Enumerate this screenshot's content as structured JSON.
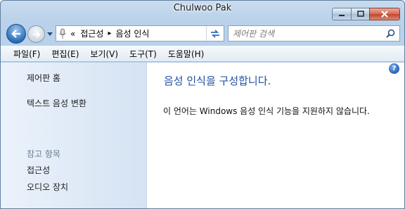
{
  "window": {
    "title": "Chulwoo Pak"
  },
  "address": {
    "chevron": "«",
    "segments": [
      "접근성",
      "음성 인식"
    ],
    "separator": "▸"
  },
  "search": {
    "placeholder": "제어판 검색"
  },
  "menu": [
    "파일(F)",
    "편집(E)",
    "보기(V)",
    "도구(T)",
    "도움말(H)"
  ],
  "sidebar": {
    "links": [
      "제어판 홈",
      "텍스트 음성 변환"
    ],
    "see_also_heading": "참고 항목",
    "see_also": [
      "접근성",
      "오디오 장치"
    ]
  },
  "main": {
    "title": "음성 인식을 구성합니다.",
    "description": "이 언어는 Windows 음성 인식 기능을 지원하지 않습니다."
  },
  "help": {
    "glyph": "?"
  },
  "icons": {
    "back": "back-arrow-icon",
    "forward": "forward-arrow-icon",
    "address": "microphone-icon",
    "refresh": "refresh-icon",
    "search": "magnifier-icon",
    "help": "help-icon"
  }
}
